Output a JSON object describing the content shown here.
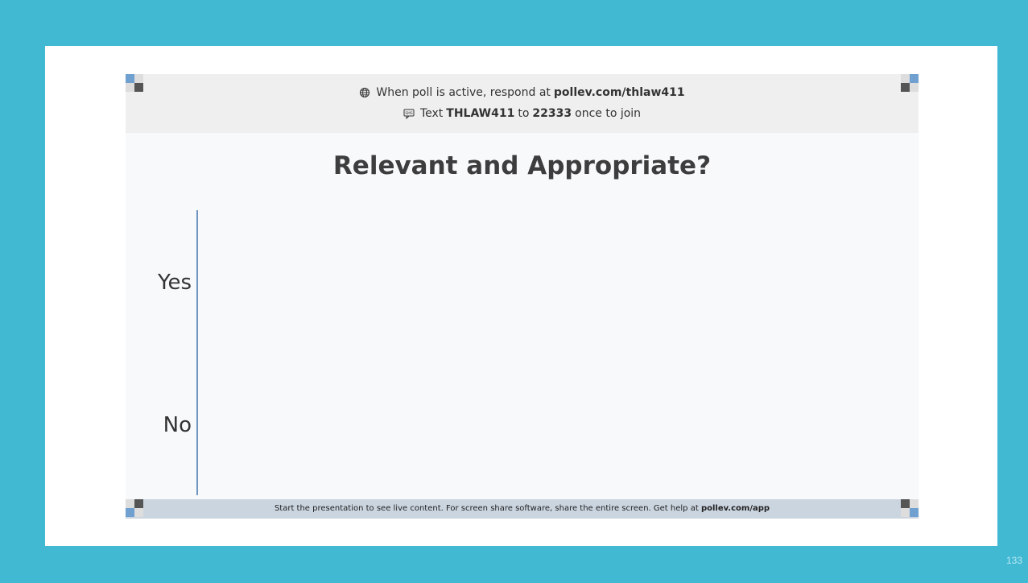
{
  "header": {
    "line1_prefix": "When poll is active, respond at",
    "line1_url": "pollev.com/thlaw411",
    "line2_prefix": "Text",
    "line2_code": "THLAW411",
    "line2_mid": "to",
    "line2_number": "22333",
    "line2_suffix": "once to join"
  },
  "poll": {
    "title": "Relevant and Appropriate?"
  },
  "chart_data": {
    "type": "bar",
    "orientation": "horizontal",
    "categories": [
      "Yes",
      "No"
    ],
    "values": [
      0,
      0
    ],
    "axis_color": "#6f95c0"
  },
  "footer": {
    "text": "Start the presentation to see live content. For screen share software, share the entire screen. Get help at",
    "link": "pollev.com/app"
  },
  "slide": {
    "number": "133"
  },
  "colors": {
    "background": "#41b9d3",
    "accent_blue": "#6fa0d0",
    "corner_dark": "#555555"
  },
  "icons": {
    "globe": "globe-icon",
    "sms": "sms-icon"
  }
}
